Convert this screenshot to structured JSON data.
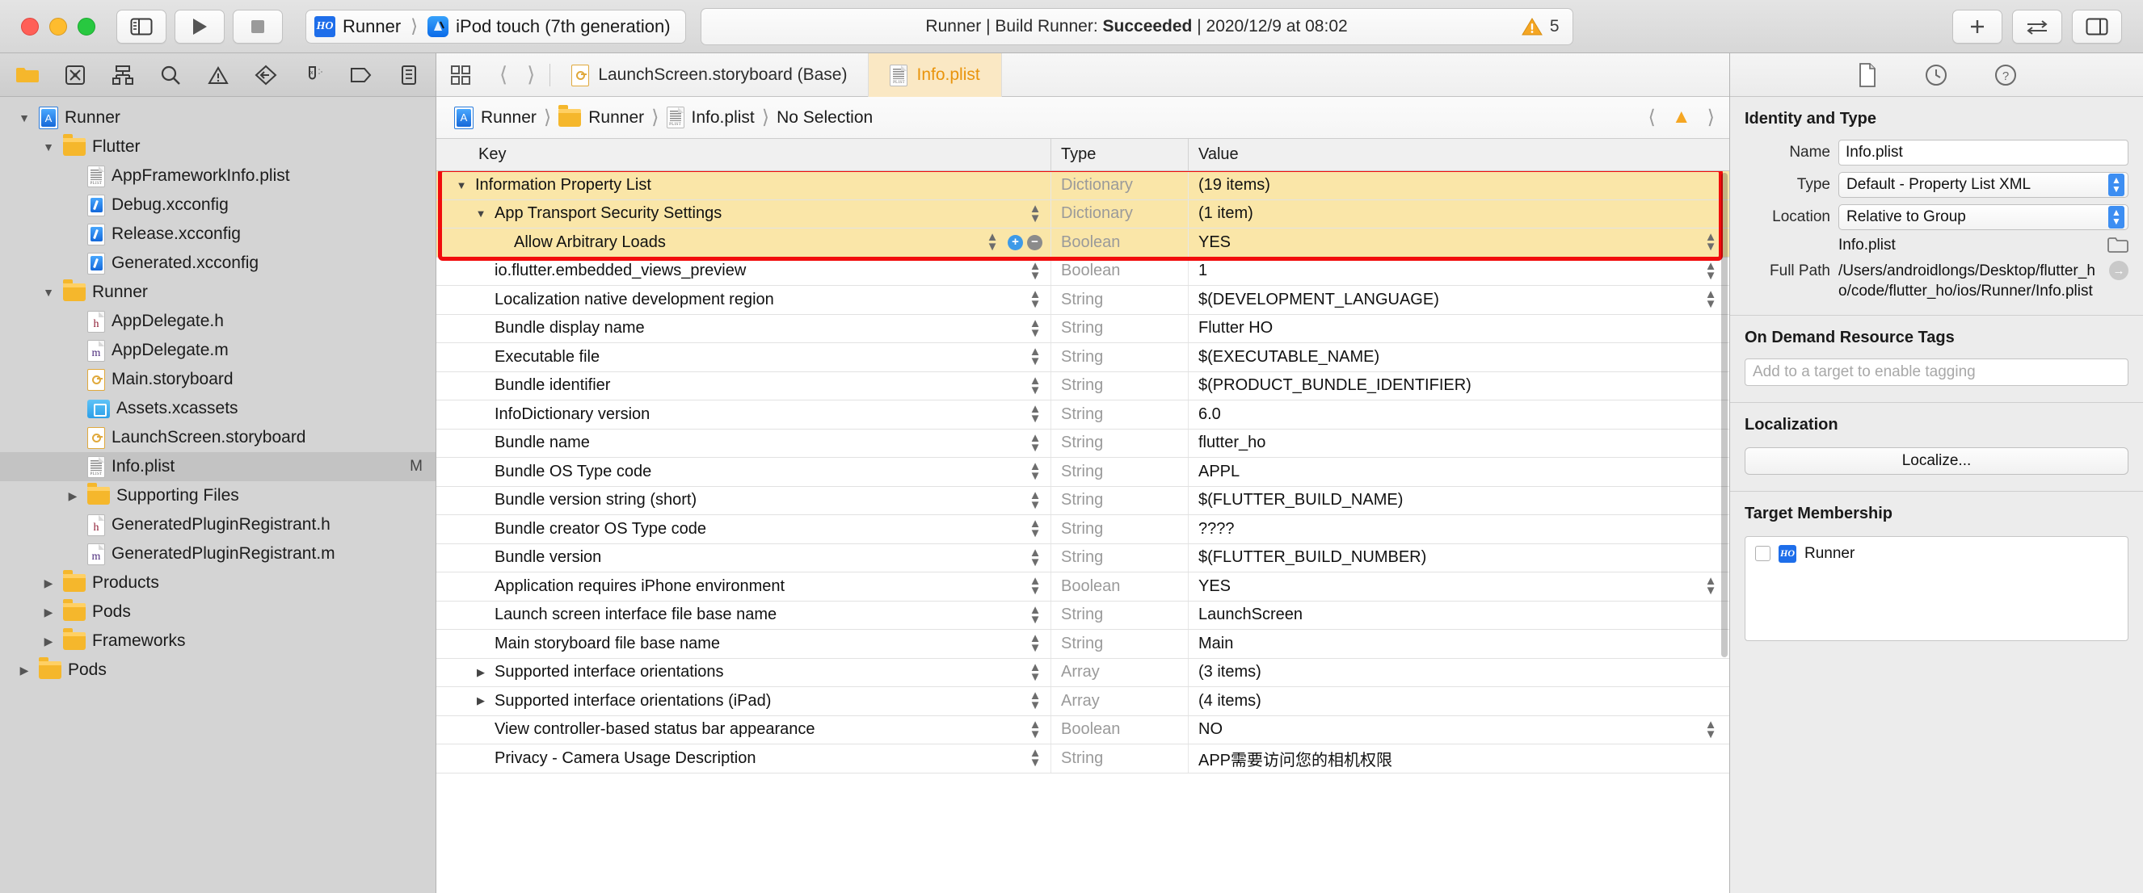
{
  "titlebar": {
    "scheme_app": "Runner",
    "scheme_destination": "iPod touch (7th generation)",
    "status_prefix": "Runner | Build Runner: ",
    "status_result": "Succeeded",
    "status_suffix": " | 2020/12/9 at 08:02",
    "warning_count": "5",
    "icons": {
      "sidebar_toggle": "sidebar-toggle-icon",
      "run": "run-icon",
      "stop": "stop-icon",
      "add": "add-icon",
      "swap": "swap-editor-icon",
      "right_panel": "right-panel-toggle-icon"
    }
  },
  "navigator": {
    "toolbar_icons": [
      "folder-icon",
      "x-box-icon",
      "hierarchy-icon",
      "search-icon",
      "warning-triangle-icon",
      "diamond-arrow-icon",
      "test-tube-icon",
      "tag-icon",
      "list-icon"
    ],
    "items": [
      {
        "label": "Runner",
        "icon": "xcode-project-icon",
        "indent": 0,
        "disclosure": "open",
        "selected": false,
        "status": ""
      },
      {
        "label": "Flutter",
        "icon": "folder-icon",
        "indent": 1,
        "disclosure": "open",
        "selected": false,
        "status": ""
      },
      {
        "label": "AppFrameworkInfo.plist",
        "icon": "plist-icon",
        "indent": 2,
        "disclosure": "none",
        "selected": false,
        "status": ""
      },
      {
        "label": "Debug.xcconfig",
        "icon": "xcconfig-icon",
        "indent": 2,
        "disclosure": "none",
        "selected": false,
        "status": ""
      },
      {
        "label": "Release.xcconfig",
        "icon": "xcconfig-icon",
        "indent": 2,
        "disclosure": "none",
        "selected": false,
        "status": ""
      },
      {
        "label": "Generated.xcconfig",
        "icon": "xcconfig-icon",
        "indent": 2,
        "disclosure": "none",
        "selected": false,
        "status": ""
      },
      {
        "label": "Runner",
        "icon": "folder-icon",
        "indent": 1,
        "disclosure": "open",
        "selected": false,
        "status": ""
      },
      {
        "label": "AppDelegate.h",
        "icon": "header-file-icon",
        "indent": 2,
        "disclosure": "none",
        "selected": false,
        "status": ""
      },
      {
        "label": "AppDelegate.m",
        "icon": "objc-file-icon",
        "indent": 2,
        "disclosure": "none",
        "selected": false,
        "status": ""
      },
      {
        "label": "Main.storyboard",
        "icon": "storyboard-icon",
        "indent": 2,
        "disclosure": "none",
        "selected": false,
        "status": ""
      },
      {
        "label": "Assets.xcassets",
        "icon": "xcassets-icon",
        "indent": 2,
        "disclosure": "none",
        "selected": false,
        "status": ""
      },
      {
        "label": "LaunchScreen.storyboard",
        "icon": "storyboard-icon",
        "indent": 2,
        "disclosure": "none",
        "selected": false,
        "status": ""
      },
      {
        "label": "Info.plist",
        "icon": "plist-icon",
        "indent": 2,
        "disclosure": "none",
        "selected": true,
        "status": "M"
      },
      {
        "label": "Supporting Files",
        "icon": "folder-icon",
        "indent": 2,
        "disclosure": "closed",
        "selected": false,
        "status": ""
      },
      {
        "label": "GeneratedPluginRegistrant.h",
        "icon": "header-file-icon",
        "indent": 2,
        "disclosure": "none",
        "selected": false,
        "status": ""
      },
      {
        "label": "GeneratedPluginRegistrant.m",
        "icon": "objc-file-icon",
        "indent": 2,
        "disclosure": "none",
        "selected": false,
        "status": ""
      },
      {
        "label": "Products",
        "icon": "folder-icon",
        "indent": 1,
        "disclosure": "closed",
        "selected": false,
        "status": ""
      },
      {
        "label": "Pods",
        "icon": "folder-icon",
        "indent": 1,
        "disclosure": "closed",
        "selected": false,
        "status": ""
      },
      {
        "label": "Frameworks",
        "icon": "folder-icon",
        "indent": 1,
        "disclosure": "closed",
        "selected": false,
        "status": ""
      },
      {
        "label": "Pods",
        "icon": "folder-icon",
        "indent": 0,
        "disclosure": "closed",
        "selected": false,
        "status": ""
      }
    ]
  },
  "editor": {
    "tabs": [
      {
        "label": "LaunchScreen.storyboard (Base)",
        "icon": "storyboard-icon",
        "active": false
      },
      {
        "label": "Info.plist",
        "icon": "plist-icon",
        "active": true
      }
    ],
    "breadcrumb": [
      "Runner",
      "Runner",
      "Info.plist",
      "No Selection"
    ],
    "columns": {
      "key": "Key",
      "type": "Type",
      "value": "Value"
    },
    "rows": [
      {
        "key": "Information Property List",
        "type": "Dictionary",
        "value": "(19 items)",
        "indent": 0,
        "disclosure": "open",
        "highlight": true,
        "stepper": false
      },
      {
        "key": "App Transport Security Settings",
        "type": "Dictionary",
        "value": "(1 item)",
        "indent": 1,
        "disclosure": "open",
        "highlight": true,
        "stepper": true
      },
      {
        "key": "Allow Arbitrary Loads",
        "type": "Boolean",
        "value": "YES",
        "indent": 2,
        "disclosure": "none",
        "highlight": true,
        "stepper": true,
        "plusminus": true,
        "value_stepper": true
      },
      {
        "key": "io.flutter.embedded_views_preview",
        "type": "Boolean",
        "value": "1",
        "indent": 1,
        "disclosure": "none",
        "highlight": false,
        "stepper": true,
        "value_stepper": true
      },
      {
        "key": "Localization native development region",
        "type": "String",
        "value": "$(DEVELOPMENT_LANGUAGE)",
        "indent": 1,
        "disclosure": "none",
        "highlight": false,
        "stepper": true,
        "value_stepper": true
      },
      {
        "key": "Bundle display name",
        "type": "String",
        "value": "Flutter HO",
        "indent": 1,
        "disclosure": "none",
        "highlight": false,
        "stepper": true
      },
      {
        "key": "Executable file",
        "type": "String",
        "value": "$(EXECUTABLE_NAME)",
        "indent": 1,
        "disclosure": "none",
        "highlight": false,
        "stepper": true
      },
      {
        "key": "Bundle identifier",
        "type": "String",
        "value": "$(PRODUCT_BUNDLE_IDENTIFIER)",
        "indent": 1,
        "disclosure": "none",
        "highlight": false,
        "stepper": true
      },
      {
        "key": "InfoDictionary version",
        "type": "String",
        "value": "6.0",
        "indent": 1,
        "disclosure": "none",
        "highlight": false,
        "stepper": true
      },
      {
        "key": "Bundle name",
        "type": "String",
        "value": "flutter_ho",
        "indent": 1,
        "disclosure": "none",
        "highlight": false,
        "stepper": true
      },
      {
        "key": "Bundle OS Type code",
        "type": "String",
        "value": "APPL",
        "indent": 1,
        "disclosure": "none",
        "highlight": false,
        "stepper": true
      },
      {
        "key": "Bundle version string (short)",
        "type": "String",
        "value": "$(FLUTTER_BUILD_NAME)",
        "indent": 1,
        "disclosure": "none",
        "highlight": false,
        "stepper": true
      },
      {
        "key": "Bundle creator OS Type code",
        "type": "String",
        "value": "????",
        "indent": 1,
        "disclosure": "none",
        "highlight": false,
        "stepper": true
      },
      {
        "key": "Bundle version",
        "type": "String",
        "value": "$(FLUTTER_BUILD_NUMBER)",
        "indent": 1,
        "disclosure": "none",
        "highlight": false,
        "stepper": true
      },
      {
        "key": "Application requires iPhone environment",
        "type": "Boolean",
        "value": "YES",
        "indent": 1,
        "disclosure": "none",
        "highlight": false,
        "stepper": true,
        "value_stepper": true
      },
      {
        "key": "Launch screen interface file base name",
        "type": "String",
        "value": "LaunchScreen",
        "indent": 1,
        "disclosure": "none",
        "highlight": false,
        "stepper": true
      },
      {
        "key": "Main storyboard file base name",
        "type": "String",
        "value": "Main",
        "indent": 1,
        "disclosure": "none",
        "highlight": false,
        "stepper": true
      },
      {
        "key": "Supported interface orientations",
        "type": "Array",
        "value": "(3 items)",
        "indent": 1,
        "disclosure": "closed",
        "highlight": false,
        "stepper": true
      },
      {
        "key": "Supported interface orientations (iPad)",
        "type": "Array",
        "value": "(4 items)",
        "indent": 1,
        "disclosure": "closed",
        "highlight": false,
        "stepper": true
      },
      {
        "key": "View controller-based status bar appearance",
        "type": "Boolean",
        "value": "NO",
        "indent": 1,
        "disclosure": "none",
        "highlight": false,
        "stepper": true,
        "value_stepper": true
      },
      {
        "key": "Privacy - Camera Usage Description",
        "type": "String",
        "value": "APP需要访问您的相机权限",
        "indent": 1,
        "disclosure": "none",
        "highlight": false,
        "stepper": true
      }
    ]
  },
  "inspector": {
    "tabs": [
      "file-inspector-icon",
      "history-inspector-icon",
      "quick-help-icon"
    ],
    "identity": {
      "title": "Identity and Type",
      "name_label": "Name",
      "name_value": "Info.plist",
      "type_label": "Type",
      "type_value": "Default - Property List XML",
      "location_label": "Location",
      "location_value": "Relative to Group",
      "location_file": "Info.plist",
      "fullpath_label": "Full Path",
      "fullpath_value": "/Users/androidlongs/Desktop/flutter_ho/code/flutter_ho/ios/Runner/Info.plist"
    },
    "ondemand": {
      "title": "On Demand Resource Tags",
      "placeholder": "Add to a target to enable tagging"
    },
    "localization": {
      "title": "Localization",
      "button": "Localize..."
    },
    "target_membership": {
      "title": "Target Membership",
      "items": [
        {
          "label": "Runner",
          "checked": false,
          "icon": "app-target-icon"
        }
      ]
    }
  },
  "colors": {
    "accent_orange": "#e9940c",
    "highlight_yellow": "#fae6a8",
    "red_annotation": "#f10c0c",
    "selection_gray": "#c3c3c3"
  }
}
